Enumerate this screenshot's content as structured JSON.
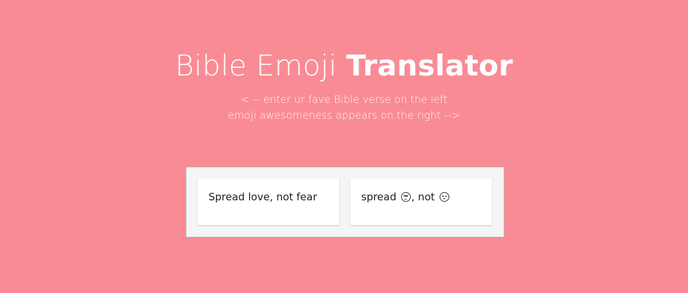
{
  "header": {
    "title_light": "Bible Emoji",
    "title_bold": "Translator",
    "subtitle_line1": "< -- enter ur fave Bible verse on the left",
    "subtitle_line2": "emoji awesomeness appears on the right -->"
  },
  "translator": {
    "input_value": "Spread love, not fear",
    "output_prefix": "spread",
    "output_middle": ", not",
    "emoji_1": "smiling-face-with-heart-eyes-icon",
    "emoji_2": "fearful-face-icon"
  },
  "colors": {
    "background": "#f98b95",
    "panel_bg": "#f5f5f5",
    "card_bg": "#ffffff",
    "text_dark": "#222222",
    "heading": "#ffffff"
  }
}
